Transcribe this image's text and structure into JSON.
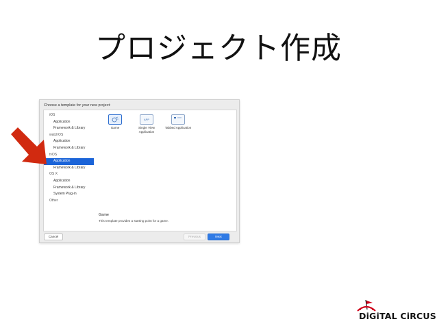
{
  "slide": {
    "title": "プロジェクト作成"
  },
  "dialog": {
    "header": "Choose a template for your new project:",
    "sidebar": [
      {
        "label": "iOS",
        "kind": "head"
      },
      {
        "label": "Application",
        "kind": "item"
      },
      {
        "label": "Framework & Library",
        "kind": "item"
      },
      {
        "label": "watchOS",
        "kind": "head"
      },
      {
        "label": "Application",
        "kind": "item"
      },
      {
        "label": "Framework & Library",
        "kind": "item"
      },
      {
        "label": "tvOS",
        "kind": "head"
      },
      {
        "label": "Application",
        "kind": "item",
        "selected": true
      },
      {
        "label": "Framework & Library",
        "kind": "item"
      },
      {
        "label": "OS X",
        "kind": "head"
      },
      {
        "label": "Application",
        "kind": "item"
      },
      {
        "label": "Framework & Library",
        "kind": "item"
      },
      {
        "label": "System Plug-in",
        "kind": "item"
      },
      {
        "label": "Other",
        "kind": "head"
      }
    ],
    "templates": [
      {
        "label": "Game",
        "icon": "game-icon",
        "selected": true
      },
      {
        "label": "Single View Application",
        "icon": "app-icon",
        "badge": "APP"
      },
      {
        "label": "Tabbed Application",
        "icon": "tabbed-icon"
      }
    ],
    "description": {
      "title": "Game",
      "text": "This template provides a starting point for a game."
    },
    "buttons": {
      "cancel": "Cancel",
      "previous": "Previous",
      "next": "Next"
    }
  },
  "logo": {
    "text": "DiGiTAL CiRCUS"
  },
  "colors": {
    "arrow": "#d12a10",
    "selection": "#1b64d8",
    "next_button": "#2f7ae5",
    "logo_accent": "#d0021b"
  }
}
